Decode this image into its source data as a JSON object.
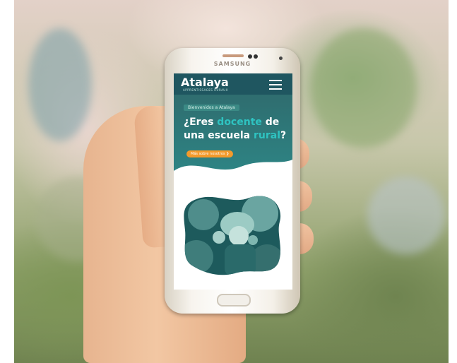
{
  "phone": {
    "brand": "SAMSUNG"
  },
  "app": {
    "logo": "Atalaya",
    "logo_sub": "APPRENTISSAGES RURAUX"
  },
  "hero": {
    "pill": "Bienvenidos a Atalaya",
    "headline_part1": "¿Eres ",
    "headline_highlight1": "docente",
    "headline_part2": " de",
    "headline_part3": "una escuela ",
    "headline_highlight2": "rural",
    "headline_end": "?",
    "cta": "Más sobre nosotros ❯"
  },
  "colors": {
    "topbar": "#1f5660",
    "hero": "#2f7a7a",
    "highlight": "#2ec3c1",
    "cta": "#f39a2b"
  }
}
